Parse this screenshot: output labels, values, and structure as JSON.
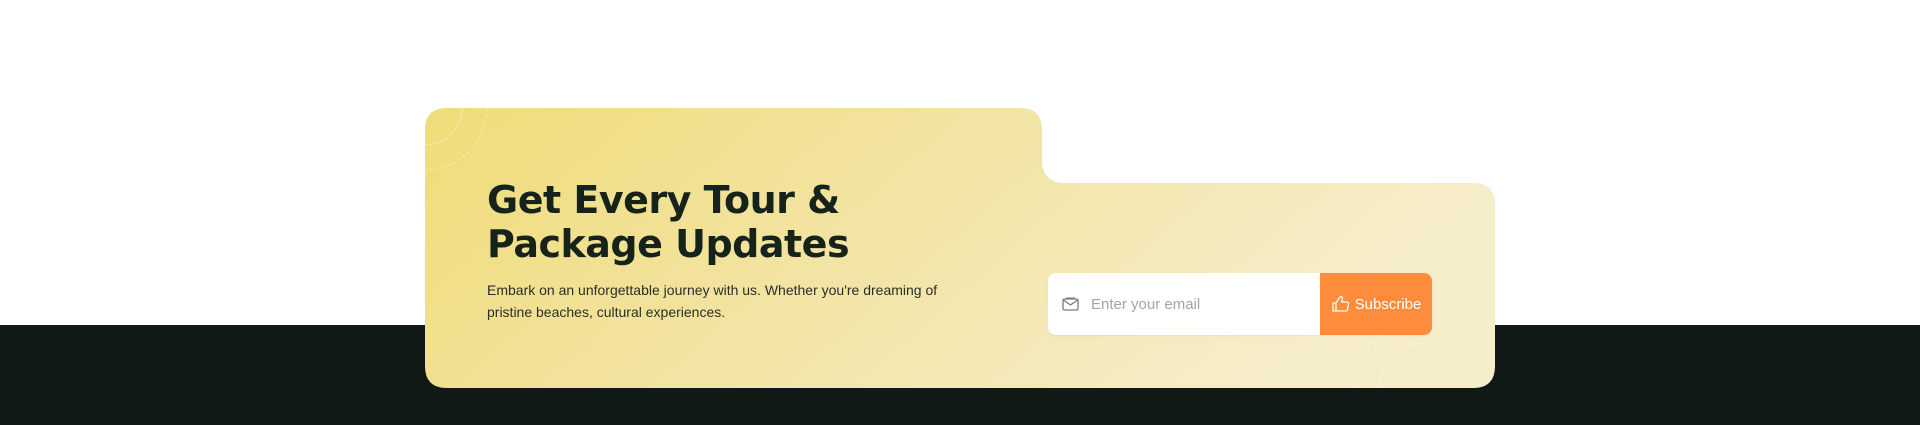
{
  "newsletter": {
    "heading_line1": "Get Every Tour &",
    "heading_line2": "Package Updates",
    "description_line1": "Embark on an unforgettable journey with us. Whether you're dreaming of",
    "description_line2": "pristine beaches, cultural experiences.",
    "email_placeholder": "Enter your email",
    "email_value": "",
    "subscribe_label": "Subscribe",
    "icons": {
      "email": "envelope-icon",
      "subscribe": "thumbs-up-icon"
    }
  },
  "colors": {
    "card_gradient_start": "#f0dc78",
    "card_gradient_end": "#f6edcb",
    "subscribe_button": "#ff8b3d",
    "footer_background": "#101915",
    "heading_text": "#15231a"
  }
}
